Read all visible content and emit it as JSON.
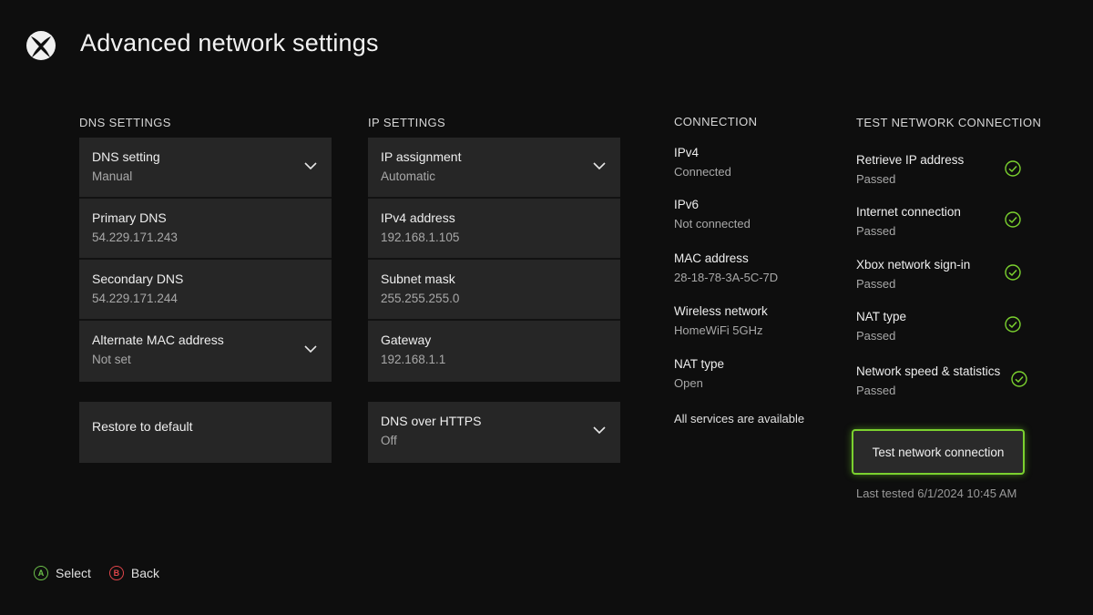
{
  "header": {
    "title": "Advanced network settings",
    "logo_icon": "xbox-logo-icon"
  },
  "dns": {
    "heading": "DNS SETTINGS",
    "rows": [
      {
        "title": "DNS setting",
        "value": "Manual",
        "dropdown": true
      },
      {
        "title": "Primary DNS",
        "value": "54.229.171.243"
      },
      {
        "title": "Secondary DNS",
        "value": "54.229.171.244"
      },
      {
        "title": "Alternate MAC address",
        "value": "Not set",
        "dropdown": true
      }
    ],
    "restore_label": "Restore to default"
  },
  "ip": {
    "heading": "IP SETTINGS",
    "rows": [
      {
        "title": "IP assignment",
        "value": "Automatic",
        "dropdown": true
      },
      {
        "title": "IPv4 address",
        "value": "192.168.1.105"
      },
      {
        "title": "Subnet mask",
        "value": "255.255.255.0"
      },
      {
        "title": "Gateway",
        "value": "192.168.1.1"
      }
    ],
    "doh": {
      "title": "DNS over HTTPS",
      "value": "Off",
      "dropdown": true
    }
  },
  "connection": {
    "heading": "CONNECTION",
    "items": [
      {
        "label": "IPv4",
        "value": "Connected"
      },
      {
        "label": "IPv6",
        "value": "Not connected"
      },
      {
        "label": "MAC address",
        "value": "28-18-78-3A-5C-7D"
      },
      {
        "label": "Wireless network",
        "value": "HomeWiFi 5GHz"
      },
      {
        "label": "NAT type",
        "value": "Open"
      }
    ],
    "status_note": "All services are available"
  },
  "test": {
    "heading": "TEST NETWORK CONNECTION",
    "items": [
      {
        "label": "Retrieve IP address",
        "value": "Passed"
      },
      {
        "label": "Internet connection",
        "value": "Passed"
      },
      {
        "label": "Xbox network sign-in",
        "value": "Passed"
      },
      {
        "label": "NAT type",
        "value": "Passed"
      },
      {
        "label": "Network speed & statistics",
        "value": "Passed"
      }
    ],
    "button_label": "Test network connection",
    "last_tested": "Last tested 6/1/2024 10:45 AM"
  },
  "footer": {
    "a_glyph": "A",
    "a_label": "Select",
    "b_glyph": "B",
    "b_label": "Back"
  },
  "colors": {
    "background": "#0e0e0e",
    "panel": "#262626",
    "accent_green": "#7bd12f",
    "a_button": "#6cc04a",
    "b_button": "#e0454a"
  }
}
